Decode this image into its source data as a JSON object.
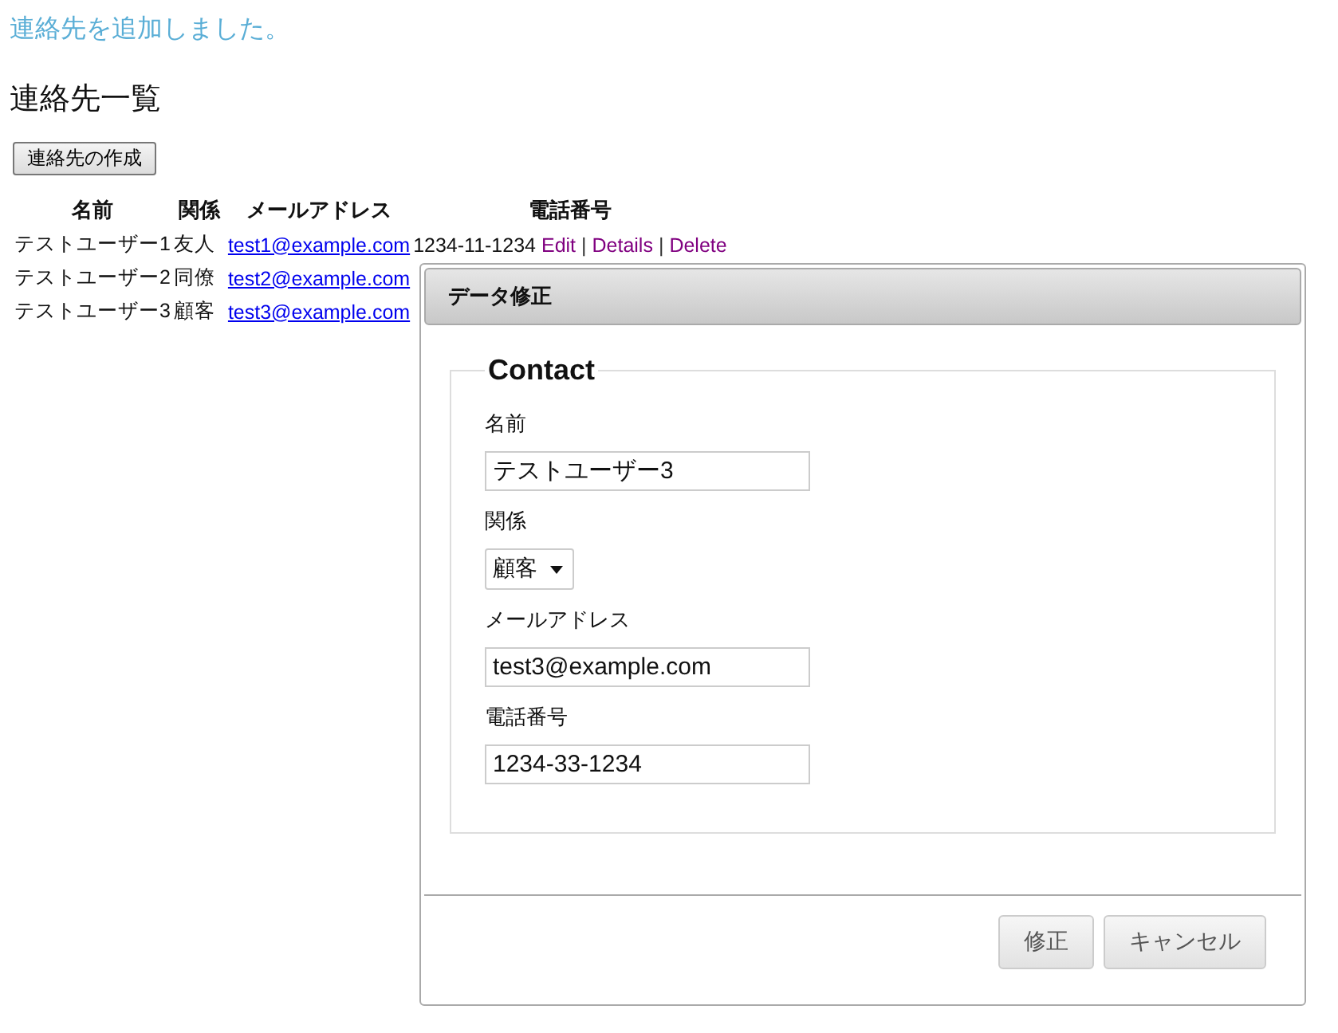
{
  "message": "連絡先を追加しました。",
  "heading": "連絡先一覧",
  "create_button": "連絡先の作成",
  "table": {
    "columns": [
      "名前",
      "関係",
      "メールアドレス",
      "電話番号"
    ],
    "rows": [
      {
        "name": "テストユーザー1",
        "relation": "友人",
        "email": "test1@example.com",
        "phone": "1234-11-1234",
        "actions": [
          {
            "kind": "link",
            "text": "Edit"
          },
          {
            "kind": "separator",
            "text": "|"
          },
          {
            "kind": "link",
            "text": "Details"
          },
          {
            "kind": "separator",
            "text": "|"
          },
          {
            "kind": "link",
            "text": "Delete"
          }
        ]
      },
      {
        "name": "テストユーザー2",
        "relation": "同僚",
        "email": "test2@example.com"
      },
      {
        "name": "テストユーザー3",
        "relation": "顧客",
        "email": "test3@example.com"
      }
    ]
  },
  "dialog": {
    "title": "データ修正",
    "legend": "Contact",
    "fields": [
      {
        "kind": "text",
        "label": "名前",
        "value": "テストユーザー3"
      },
      {
        "kind": "select",
        "label": "関係",
        "value": "顧客"
      },
      {
        "kind": "text",
        "label": "メールアドレス",
        "value": "test3@example.com"
      },
      {
        "kind": "text",
        "label": "電話番号",
        "value": "1234-33-1234"
      }
    ],
    "buttons": [
      "修正",
      "キャンセル"
    ]
  }
}
